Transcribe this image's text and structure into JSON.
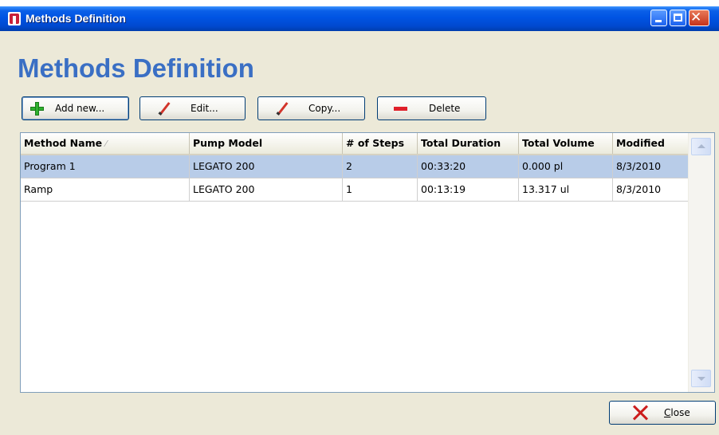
{
  "window": {
    "title": "Methods Definition",
    "heading": "Methods Definition",
    "controls": [
      "minimize-icon",
      "maximize-icon",
      "close-icon"
    ]
  },
  "toolbar": {
    "add_label": "Add new...",
    "edit_label": "Edit...",
    "copy_label": "Copy...",
    "delete_label": "Delete"
  },
  "table": {
    "columns": [
      "Method Name",
      "Pump Model",
      "# of Steps",
      "Total Duration",
      "Total Volume",
      "Modified"
    ],
    "sort_indicator": "⁄",
    "rows": [
      [
        "Program 1",
        "LEGATO 200",
        "2",
        "00:33:20",
        "0.000 pl",
        "8/3/2010"
      ],
      [
        "Ramp",
        "LEGATO 200",
        "1",
        "00:13:19",
        "13.317 ul",
        "8/3/2010"
      ]
    ],
    "selected_row": 0
  },
  "footer": {
    "close_label": "Close",
    "close_mnemonic": "C"
  },
  "colors": {
    "title_bar": "#0054e3",
    "heading": "#3a6fc4",
    "selected_row": "#b8cce8",
    "window_bg": "#ece9d8"
  }
}
